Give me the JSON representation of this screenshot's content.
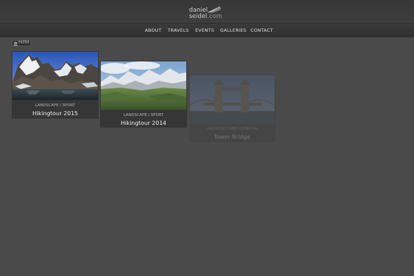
{
  "header": {
    "logo_line1": "daniel",
    "logo_line2": "seidel",
    "logo_domain": ".com"
  },
  "nav": {
    "items": [
      {
        "label": "ABOUT"
      },
      {
        "label": "TRAVELS"
      },
      {
        "label": "EVENTS"
      },
      {
        "label": "GALLERIES"
      },
      {
        "label": "CONTACT"
      }
    ]
  },
  "filter": {
    "label": "FILTER",
    "icon": "menu-icon"
  },
  "galleries": [
    {
      "category": "LANDSCAPE / SPORT",
      "title": "Hikingtour 2015"
    },
    {
      "category": "LANDSCAPE / SPORT",
      "title": "Hikingtour 2014"
    },
    {
      "category": "ARCHITECTURE / LONDON",
      "title": "Tower Bridge"
    }
  ],
  "colors": {
    "background": "#4a4a4a",
    "card": "#363636",
    "header": "#3a3a3a",
    "text": "#e2e2e2"
  }
}
